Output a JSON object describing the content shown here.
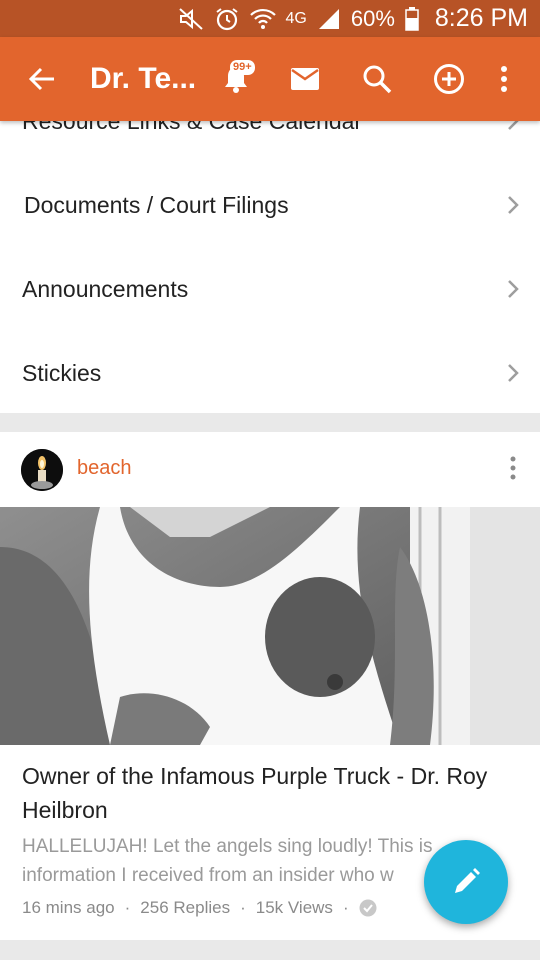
{
  "status_bar": {
    "network": "4G",
    "battery": "60%",
    "time": "8:26 PM"
  },
  "app_bar": {
    "title": "Dr. Te...",
    "notification_badge": "99+"
  },
  "menu": {
    "items": [
      {
        "label": "Resource Links & Case Calendar"
      },
      {
        "label": "Documents / Court Filings"
      },
      {
        "label": "Announcements"
      },
      {
        "label": "Stickies"
      }
    ]
  },
  "post": {
    "author": "beach",
    "title": "Owner of the Infamous Purple Truck - Dr. Roy Heilbron",
    "excerpt": "HALLELUJAH! Let the angels sing loudly! This is information I received from an insider who w",
    "time_ago": "16 mins ago",
    "replies": "256 Replies",
    "views": "15k Views"
  },
  "colors": {
    "status_bar": "#b75326",
    "app_bar": "#e2652d",
    "accent": "#e2652d",
    "fab": "#1fb5dc"
  }
}
